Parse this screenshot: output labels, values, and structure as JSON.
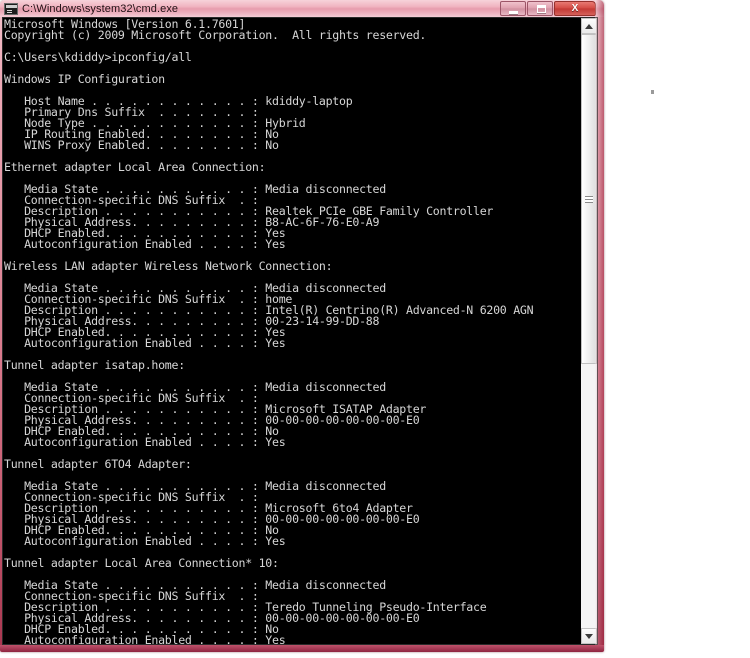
{
  "window": {
    "title": "C:\\Windows\\system32\\cmd.exe",
    "icon": "cmd-icon",
    "buttons": {
      "minimize": "–",
      "maximize": "❐",
      "close": "X"
    }
  },
  "scrollbar": {
    "up_arrow": "scroll-up-arrow",
    "down_arrow": "scroll-down-arrow"
  },
  "console": {
    "lines": [
      "Microsoft Windows [Version 6.1.7601]",
      "Copyright (c) 2009 Microsoft Corporation.  All rights reserved.",
      "",
      "C:\\Users\\kdiddy>ipconfig/all",
      "",
      "Windows IP Configuration",
      "",
      "   Host Name . . . . . . . . . . . . : kdiddy-laptop",
      "   Primary Dns Suffix  . . . . . . . :",
      "   Node Type . . . . . . . . . . . . : Hybrid",
      "   IP Routing Enabled. . . . . . . . : No",
      "   WINS Proxy Enabled. . . . . . . . : No",
      "",
      "Ethernet adapter Local Area Connection:",
      "",
      "   Media State . . . . . . . . . . . : Media disconnected",
      "   Connection-specific DNS Suffix  . :",
      "   Description . . . . . . . . . . . : Realtek PCIe GBE Family Controller",
      "   Physical Address. . . . . . . . . : B8-AC-6F-76-E0-A9",
      "   DHCP Enabled. . . . . . . . . . . : Yes",
      "   Autoconfiguration Enabled . . . . : Yes",
      "",
      "Wireless LAN adapter Wireless Network Connection:",
      "",
      "   Media State . . . . . . . . . . . : Media disconnected",
      "   Connection-specific DNS Suffix  . : home",
      "   Description . . . . . . . . . . . : Intel(R) Centrino(R) Advanced-N 6200 AGN",
      "   Physical Address. . . . . . . . . : 00-23-14-99-DD-88",
      "   DHCP Enabled. . . . . . . . . . . : Yes",
      "   Autoconfiguration Enabled . . . . : Yes",
      "",
      "Tunnel adapter isatap.home:",
      "",
      "   Media State . . . . . . . . . . . : Media disconnected",
      "   Connection-specific DNS Suffix  . :",
      "   Description . . . . . . . . . . . : Microsoft ISATAP Adapter",
      "   Physical Address. . . . . . . . . : 00-00-00-00-00-00-00-E0",
      "   DHCP Enabled. . . . . . . . . . . : No",
      "   Autoconfiguration Enabled . . . . : Yes",
      "",
      "Tunnel adapter 6TO4 Adapter:",
      "",
      "   Media State . . . . . . . . . . . : Media disconnected",
      "   Connection-specific DNS Suffix  . :",
      "   Description . . . . . . . . . . . : Microsoft 6to4 Adapter",
      "   Physical Address. . . . . . . . . : 00-00-00-00-00-00-00-E0",
      "   DHCP Enabled. . . . . . . . . . . : No",
      "   Autoconfiguration Enabled . . . . : Yes",
      "",
      "Tunnel adapter Local Area Connection* 10:",
      "",
      "   Media State . . . . . . . . . . . : Media disconnected",
      "   Connection-specific DNS Suffix  . :",
      "   Description . . . . . . . . . . . : Teredo Tunneling Pseudo-Interface",
      "   Physical Address. . . . . . . . . : 00-00-00-00-00-00-00-E0",
      "   DHCP Enabled. . . . . . . . . . . : No",
      "   Autoconfiguration Enabled . . . . : Yes"
    ]
  }
}
